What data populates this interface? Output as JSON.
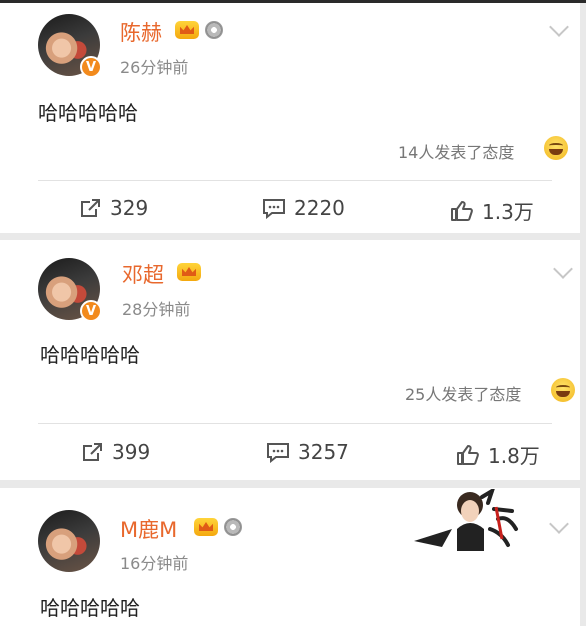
{
  "posts": [
    {
      "name": "陈赫",
      "time": "26分钟前",
      "text": "哈哈哈哈哈",
      "attitude": "14人发表了态度",
      "reposts": "329",
      "comments": "2220",
      "likes": "1.3万"
    },
    {
      "name": "邓超",
      "time": "28分钟前",
      "text": "哈哈哈哈哈",
      "attitude": "25人发表了态度",
      "reposts": "399",
      "comments": "3257",
      "likes": "1.8万"
    },
    {
      "name": "M鹿M",
      "time": "16分钟前",
      "text": "哈哈哈哈哈"
    }
  ],
  "badges": {
    "verified": "V"
  },
  "colors": {
    "name": "#e8682d",
    "accent": "#f28a1d"
  }
}
